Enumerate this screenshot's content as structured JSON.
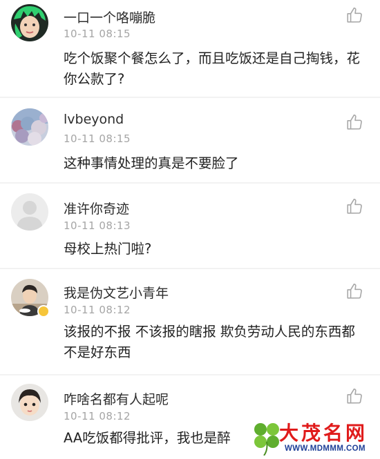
{
  "comments": [
    {
      "username": "一口一个咯嘣脆",
      "timestamp": "10-11 08:15",
      "text": "吃个饭聚个餐怎么了，而且吃饭还是自己掏钱，花你公款了?"
    },
    {
      "username": "lvbeyond",
      "timestamp": "10-11 08:15",
      "text": "这种事情处理的真是不要脸了"
    },
    {
      "username": "准许你奇迹",
      "timestamp": "10-11 08:13",
      "text": "母校上热门啦?"
    },
    {
      "username": "我是伪文艺小青年",
      "timestamp": "10-11 08:12",
      "text": "该报的不报 不该报的瞎报 欺负劳动人民的东西都不是好东西"
    },
    {
      "username": "咋啥名都有人起呢",
      "timestamp": "10-11 08:12",
      "text": "AA吃饭都得批评，我也是醉"
    }
  ],
  "icons": {
    "like": "thumbs-up-icon",
    "verified": "verified-badge-icon"
  },
  "watermark": {
    "title": "大茂名网",
    "url": "WWW.MDMMM.COM"
  },
  "colors": {
    "background": "#f2f2f2",
    "card": "#ffffff",
    "timestamp": "#a5a5a5",
    "watermark_red": "#e01b1b",
    "watermark_blue": "#1e3f97",
    "watermark_green": "#5fae2e"
  }
}
